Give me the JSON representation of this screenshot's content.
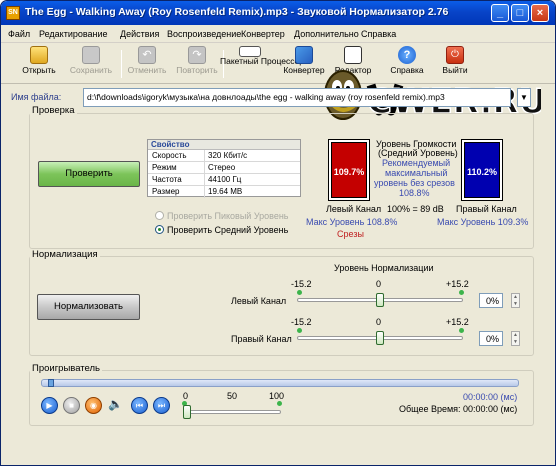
{
  "window": {
    "title": "The Egg - Walking Away (Roy Rosenfeld Remix).mp3 - Звуковой Нормализатор 2.76",
    "icon": "app-icon"
  },
  "menu": [
    "Файл",
    "Редактирование",
    "Действия",
    "Воспроизведение",
    "Конвертер",
    "Дополнительно",
    "Справка"
  ],
  "toolbar": {
    "open": "Открыть",
    "save": "Сохранить",
    "undo": "Отменить",
    "redo": "Повторить",
    "batch": "Пакетный Процессор",
    "convert": "Конвертер",
    "editor": "Редактор",
    "help": "Справка",
    "exit": "Выйти"
  },
  "file": {
    "label": "Имя файла:",
    "value": "d:\\f\\downloads\\igoryk\\музыка\\на довнлоады\\the egg - walking away (roy rosenfeld remix).mp3"
  },
  "check": {
    "group": "Проверка",
    "button": "Проверить",
    "props": {
      "header": "Свойство",
      "rows": [
        {
          "k": "Скорость",
          "v": "320 Кбит/с"
        },
        {
          "k": "Режим",
          "v": "Стерео"
        },
        {
          "k": "Частота",
          "v": "44100 Гц"
        },
        {
          "k": "Размер",
          "v": "19.64 MB"
        }
      ]
    },
    "radio_peak": "Проверить Пиковый Уровень",
    "radio_avg": "Проверить Средний Уровень",
    "left_meter": "109.7%",
    "right_meter": "110.2%",
    "loud_title": "Уровень Громкости",
    "loud_sub": "(Средний Уровень)",
    "rec1": "Рекомендуемый",
    "rec2": "максимальный",
    "rec3": "уровень без срезов",
    "rec4": "108.8%",
    "left_label": "Левый Канал",
    "ref": "100% = 89 dB",
    "right_label": "Правый Канал",
    "left_max": "Макс Уровень 108.8%",
    "right_max": "Макс Уровень 109.3%",
    "clips": "Срезы"
  },
  "norm": {
    "group": "Нормализация",
    "button": "Нормализовать",
    "title": "Уровень Нормализации",
    "min": "-15.2",
    "mid": "0",
    "max": "+15.2",
    "left": "Левый Канал",
    "right": "Правый Канал",
    "left_val": "0%",
    "right_val": "0%"
  },
  "player": {
    "group": "Проигрыватель",
    "vol_min": "0",
    "vol_mid": "50",
    "vol_max": "100",
    "pos": "00:00:00 (мс)",
    "total_label": "Общее Время:",
    "total": "00:00:00 (мс)"
  },
  "watermark": "CWER.RU",
  "colors": {
    "left_meter": "#c40000",
    "right_meter": "#0000b0",
    "accent": "#3a4bb0"
  }
}
